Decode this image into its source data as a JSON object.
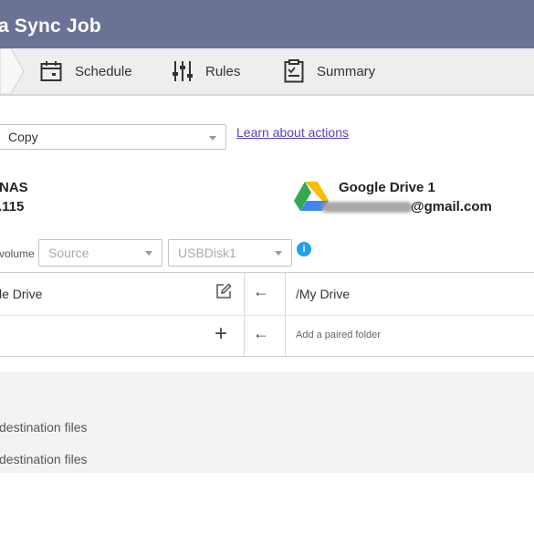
{
  "window": {
    "title": "a Sync Job"
  },
  "steps": [
    {
      "label": "Schedule",
      "icon": "calendar-icon"
    },
    {
      "label": "Rules",
      "icon": "sliders-icon"
    },
    {
      "label": "Summary",
      "icon": "clipboard-icon"
    }
  ],
  "action": {
    "selected": "Copy",
    "learn_link": "Learn about actions"
  },
  "source": {
    "name": "NAS",
    "ip": ".115"
  },
  "destination": {
    "name": "Google Drive 1",
    "email_visible": "@gmail.com"
  },
  "volume": {
    "label": "volume",
    "source_placeholder": "Source",
    "disk": "USBDisk1"
  },
  "pairs": {
    "rows": [
      {
        "local": "le Drive",
        "arrow": "←",
        "remote": "/My Drive"
      },
      {
        "local": "",
        "add": "+",
        "arrow": "←",
        "remote": "Add a paired folder"
      }
    ]
  },
  "options": [
    {
      "text": "destination files"
    },
    {
      "text": "destination files"
    }
  ],
  "colors": {
    "header": "#6a7296",
    "link": "#5a3fc0",
    "info": "#1ea0f0"
  }
}
